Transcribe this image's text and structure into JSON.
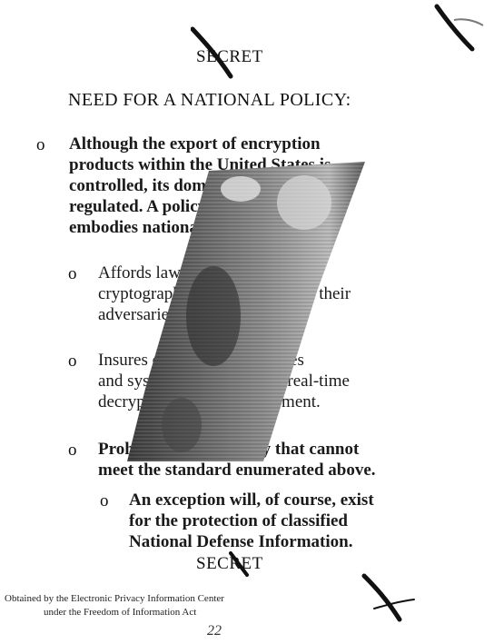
{
  "document": {
    "classification_top": "SECRET",
    "classification_bottom": "SECRET",
    "heading": "NEED FOR A NATIONAL POLICY:",
    "bullet_glyph": "o",
    "paragraphs": [
      {
        "lines": [
          "Although the export of encryption",
          "products within the United States is",
          "controlled, its domestic use is not",
          "regulated.  A policy is needed which",
          "embodies national objectives which:"
        ]
      },
      {
        "lines": [
          "Affords law enforcement",
          "cryptographic protection which their",
          "adversaries cannot defeat."
        ]
      },
      {
        "lines": [
          "Insures cryptographic devices",
          "and systems are capable of real-time",
          "decryption for law enforcement."
        ]
      },
      {
        "lines": [
          "Prohibits cryptography that cannot",
          "meet the standard enumerated above."
        ]
      },
      {
        "lines": [
          "An exception will, of course, exist",
          "for the protection of classified",
          "National Defense Information."
        ]
      }
    ],
    "footer_line1": "Obtained by the Electronic Privacy Information Center",
    "footer_line2": "under the Freedom of Information Act",
    "page_number": "22",
    "corner_stamp": "ℂ"
  }
}
